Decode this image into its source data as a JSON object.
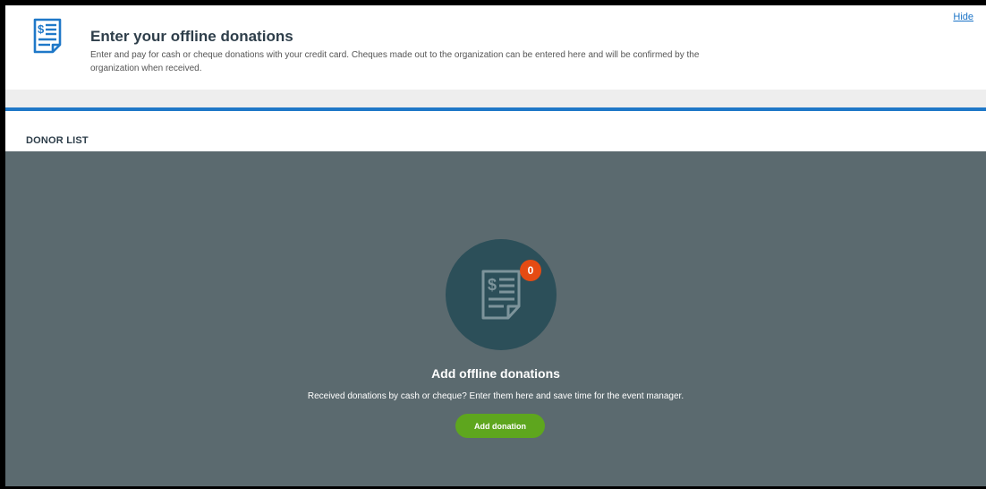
{
  "banner": {
    "icon": "invoice-dollar-icon",
    "title": "Enter your offline donations",
    "description": "Enter and pay for cash or cheque donations with your credit card. Cheques made out to the organization can be entered here and will be confirmed by the organization when received.",
    "hide_label": "Hide"
  },
  "donor_list": {
    "title": "DONOR LIST",
    "empty_state": {
      "icon": "invoice-dollar-icon",
      "badge_count": "0",
      "title": "Add offline donations",
      "description": "Received donations by cash or cheque? Enter them here and save time for the event manager.",
      "button_label": "Add donation"
    }
  },
  "colors": {
    "accent": "#1f78c8",
    "panel_background": "#5b6a6f",
    "circle": "#2c4f59",
    "badge": "#e54b13",
    "button": "#5ea61e"
  }
}
